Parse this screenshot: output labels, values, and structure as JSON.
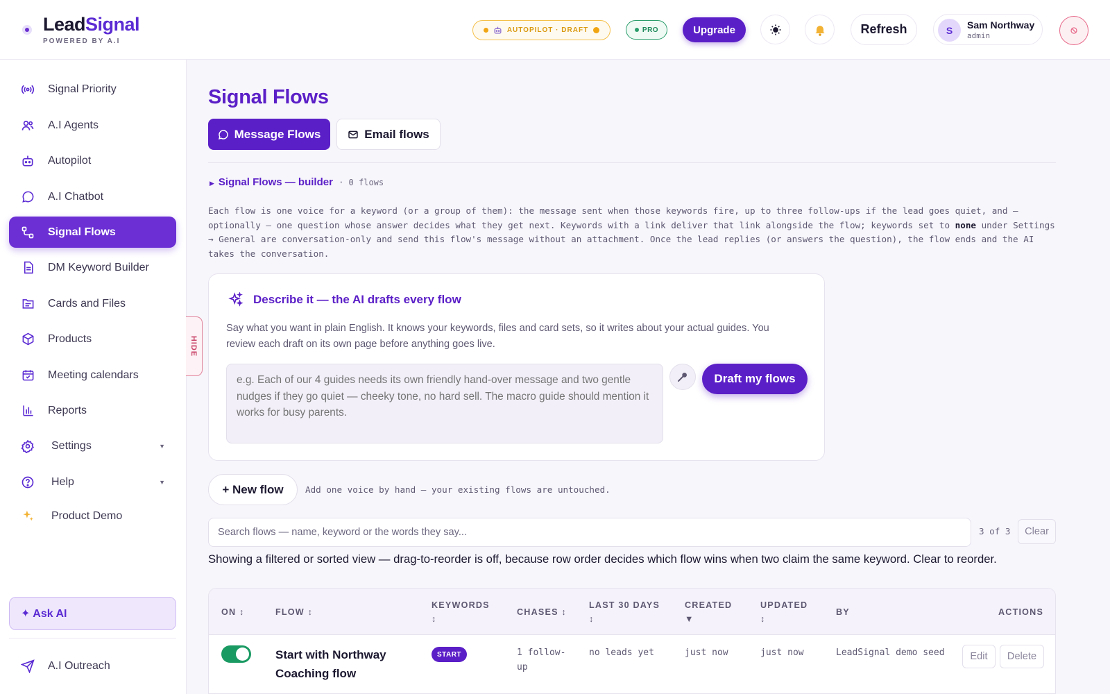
{
  "brand": {
    "name_part1": "Lead",
    "name_part2": "Signal",
    "tagline": "POWERED BY A.I"
  },
  "header": {
    "autopilot_pill": "AUTOPILOT · DRAFT",
    "pro_pill": "PRO",
    "upgrade_label": "Upgrade",
    "refresh_label": "Refresh",
    "user": {
      "initial": "S",
      "name": "Sam Northway",
      "role": "admin"
    },
    "icons": {
      "theme": "sun-icon",
      "notifications": "bell-icon",
      "power": "power-icon"
    }
  },
  "sidebar": {
    "items": [
      {
        "label": "Signal Priority",
        "icon": "signal-icon"
      },
      {
        "label": "A.I Agents",
        "icon": "agents-icon"
      },
      {
        "label": "Autopilot",
        "icon": "robot-icon"
      },
      {
        "label": "A.I Chatbot",
        "icon": "chat-icon"
      },
      {
        "label": "Signal Flows",
        "icon": "flow-icon",
        "active": true
      },
      {
        "label": "DM Keyword Builder",
        "icon": "document-icon"
      },
      {
        "label": "Cards and Files",
        "icon": "file-icon"
      },
      {
        "label": "Products",
        "icon": "box-icon"
      },
      {
        "label": "Meeting calendars",
        "icon": "calendar-icon"
      },
      {
        "label": "Reports",
        "icon": "bar-chart-icon"
      },
      {
        "label": "Settings",
        "icon": "gear-icon"
      },
      {
        "label": "Help",
        "icon": "help-icon"
      },
      {
        "label": "Product Demo",
        "icon": "sparkle-icon"
      }
    ],
    "ask_ai": "✦ Ask AI",
    "outreach": "A.I Outreach",
    "hide_tab": "HIDE"
  },
  "main": {
    "title": "Signal Flows",
    "tabs": [
      {
        "label": "Message Flows",
        "active": true
      },
      {
        "label": "Email flows",
        "active": false
      }
    ],
    "builder_title": "Signal Flows — builder",
    "builder_count": "· 0 flows",
    "intro_part1": "Each flow is one voice for a keyword (or a group of them): the message sent when those keywords fire, up to three follow-ups if the lead goes quiet, and — optionally — one question whose answer decides what they get next. Keywords with a link deliver that link alongside the flow; keywords set to ",
    "intro_bold": "none",
    "intro_part2": " under Settings → General are conversation-only and send this flow's message without an attachment. Once the lead replies (or answers the question), the flow ends and the AI takes the conversation.",
    "ai_card": {
      "title": "Describe it — the AI drafts every flow",
      "description": "Say what you want in plain English. It knows your keywords, files and card sets, so it writes about your actual guides. You review each draft on its own page before anything goes live.",
      "placeholder": "e.g. Each of our 4 guides needs its own friendly hand-over message and two gentle nudges if they go quiet — cheeky tone, no hard sell. The macro guide should mention it works for busy parents.",
      "draft_button": "Draft my flows"
    },
    "new_flow_label": "+ New flow",
    "new_flow_note": "Add one voice by hand — your existing flows are untouched.",
    "search_placeholder": "Search flows — name, keyword or the words they say...",
    "result_count": "3 of 3",
    "clear_label": "Clear",
    "filter_note": "Showing a filtered or sorted view — drag-to-reorder is off, because row order decides which flow wins when two claim the same keyword. Clear to reorder.",
    "table": {
      "headers": {
        "on": "ON ↕",
        "flow": "FLOW ↕",
        "keywords": "KEYWORDS ↕",
        "chases": "CHASES ↕",
        "last30": "LAST 30 DAYS ↕",
        "created": "CREATED ▼",
        "updated": "UPDATED ↕",
        "by": "BY",
        "actions": "ACTIONS"
      },
      "rows": [
        {
          "on": true,
          "flow": "Start with Northway Coaching flow",
          "keyword": "START",
          "chases": "1 follow-up",
          "last30": "no leads yet",
          "created": "just now",
          "updated": "just now",
          "by": "LeadSignal demo seed",
          "edit": "Edit",
          "delete": "Delete"
        }
      ]
    }
  },
  "colors": {
    "accent": "#5b1fc7",
    "toggle_on": "#1a9a63",
    "autopilot": "#f0a614",
    "pro": "#2a9d6b"
  }
}
